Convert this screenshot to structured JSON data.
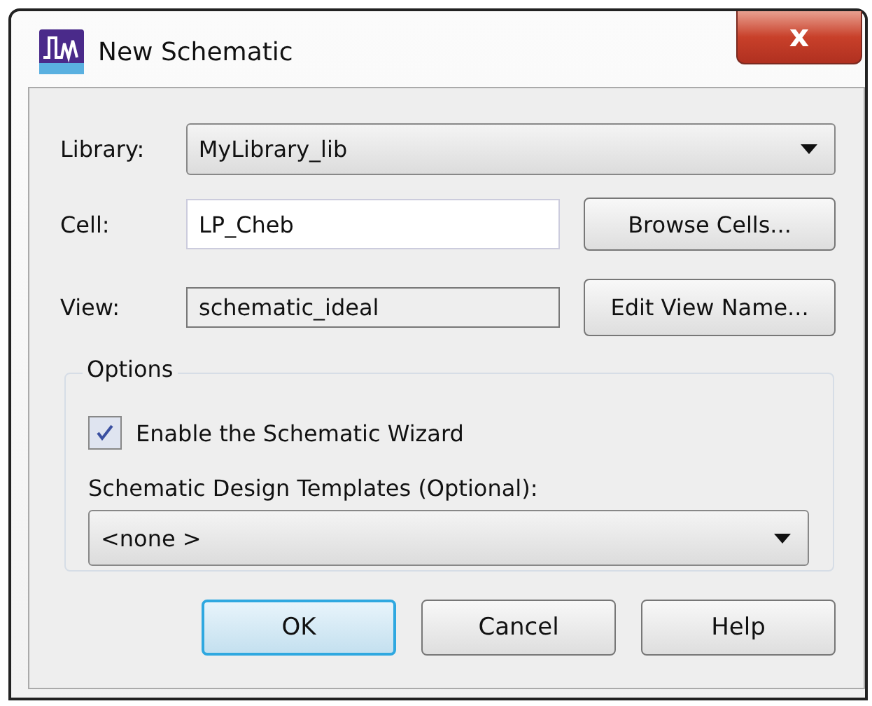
{
  "window": {
    "title": "New Schematic",
    "close": "x"
  },
  "library": {
    "label": "Library:",
    "value": "MyLibrary_lib"
  },
  "cell": {
    "label": "Cell:",
    "value": "LP_Cheb",
    "button": "Browse Cells..."
  },
  "view": {
    "label": "View:",
    "value": "schematic_ideal",
    "disabled": true,
    "button": "Edit View Name..."
  },
  "options": {
    "title": "Options",
    "wizard": {
      "label": "Enable the Schematic Wizard",
      "checked": true
    },
    "templates": {
      "label": "Schematic Design Templates (Optional):",
      "value": "<none >"
    }
  },
  "buttons": [
    {
      "label": "OK",
      "default": true
    },
    {
      "label": "Cancel",
      "default": false
    },
    {
      "label": "Help",
      "default": false
    }
  ]
}
